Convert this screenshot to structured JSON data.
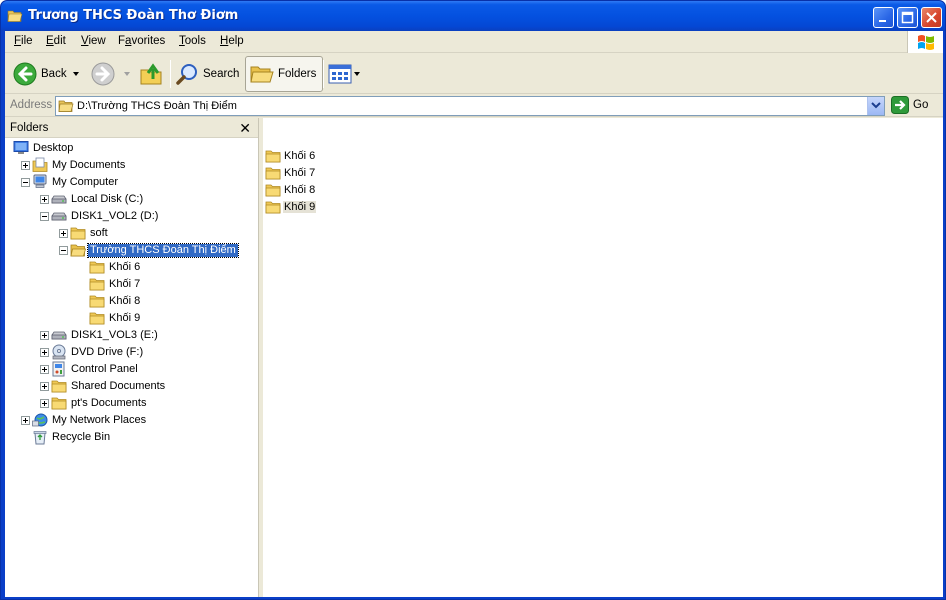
{
  "window": {
    "title": "Trương THCS Đoàn Thơ Điơm"
  },
  "menu": [
    {
      "label": "File",
      "u": "F",
      "rest": "ile"
    },
    {
      "label": "Edit",
      "u": "E",
      "rest": "dit"
    },
    {
      "label": "View",
      "u": "V",
      "rest": "iew"
    },
    {
      "label": "Favorites",
      "pre": "F",
      "u": "a",
      "rest": "vorites"
    },
    {
      "label": "Tools",
      "u": "T",
      "rest": "ools"
    },
    {
      "label": "Help",
      "u": "H",
      "rest": "elp"
    }
  ],
  "toolbar": {
    "back_label": "Back",
    "search_label": "Search",
    "folders_label": "Folders"
  },
  "address": {
    "label": "Address",
    "path": "D:\\Trường THCS Đoàn Thị Điểm",
    "go_label": "Go"
  },
  "folders_pane": {
    "title": "Folders",
    "close": "✕",
    "items": [
      {
        "label": "Desktop",
        "icon": "desktop-icon",
        "depth": 0,
        "expander": "none"
      },
      {
        "label": "My Documents",
        "icon": "my-documents-icon",
        "depth": 1,
        "expander": "plus"
      },
      {
        "label": "My Computer",
        "icon": "my-computer-icon",
        "depth": 1,
        "expander": "minus"
      },
      {
        "label": "Local Disk (C:)",
        "icon": "hard-drive-icon",
        "depth": 2,
        "expander": "plus"
      },
      {
        "label": "DISK1_VOL2 (D:)",
        "icon": "hard-drive-icon",
        "depth": 2,
        "expander": "minus"
      },
      {
        "label": "soft",
        "icon": "folder-icon",
        "depth": 3,
        "expander": "plus"
      },
      {
        "label": "Trường THCS Đoàn Thị Điểm",
        "icon": "open-folder-icon",
        "depth": 3,
        "expander": "minus",
        "selected": true
      },
      {
        "label": "Khối 6",
        "icon": "folder-icon",
        "depth": 4,
        "expander": "none"
      },
      {
        "label": "Khối 7",
        "icon": "folder-icon",
        "depth": 4,
        "expander": "none"
      },
      {
        "label": "Khối 8",
        "icon": "folder-icon",
        "depth": 4,
        "expander": "none"
      },
      {
        "label": "Khối 9",
        "icon": "folder-icon",
        "depth": 4,
        "expander": "none"
      },
      {
        "label": "DISK1_VOL3 (E:)",
        "icon": "hard-drive-icon",
        "depth": 2,
        "expander": "plus"
      },
      {
        "label": "DVD Drive (F:)",
        "icon": "dvd-drive-icon",
        "depth": 2,
        "expander": "plus"
      },
      {
        "label": "Control Panel",
        "icon": "control-panel-icon",
        "depth": 2,
        "expander": "plus"
      },
      {
        "label": "Shared Documents",
        "icon": "folder-icon",
        "depth": 2,
        "expander": "plus"
      },
      {
        "label": "pt's Documents",
        "icon": "folder-icon",
        "depth": 2,
        "expander": "plus"
      },
      {
        "label": "My Network Places",
        "icon": "network-places-icon",
        "depth": 1,
        "expander": "plus"
      },
      {
        "label": "Recycle Bin",
        "icon": "recycle-bin-icon",
        "depth": 1,
        "expander": "none"
      }
    ]
  },
  "content": {
    "items": [
      {
        "label": "Khối 6",
        "selected": false
      },
      {
        "label": "Khối 7",
        "selected": false
      },
      {
        "label": "Khối 8",
        "selected": false
      },
      {
        "label": "Khối 9",
        "selected": true
      }
    ]
  }
}
